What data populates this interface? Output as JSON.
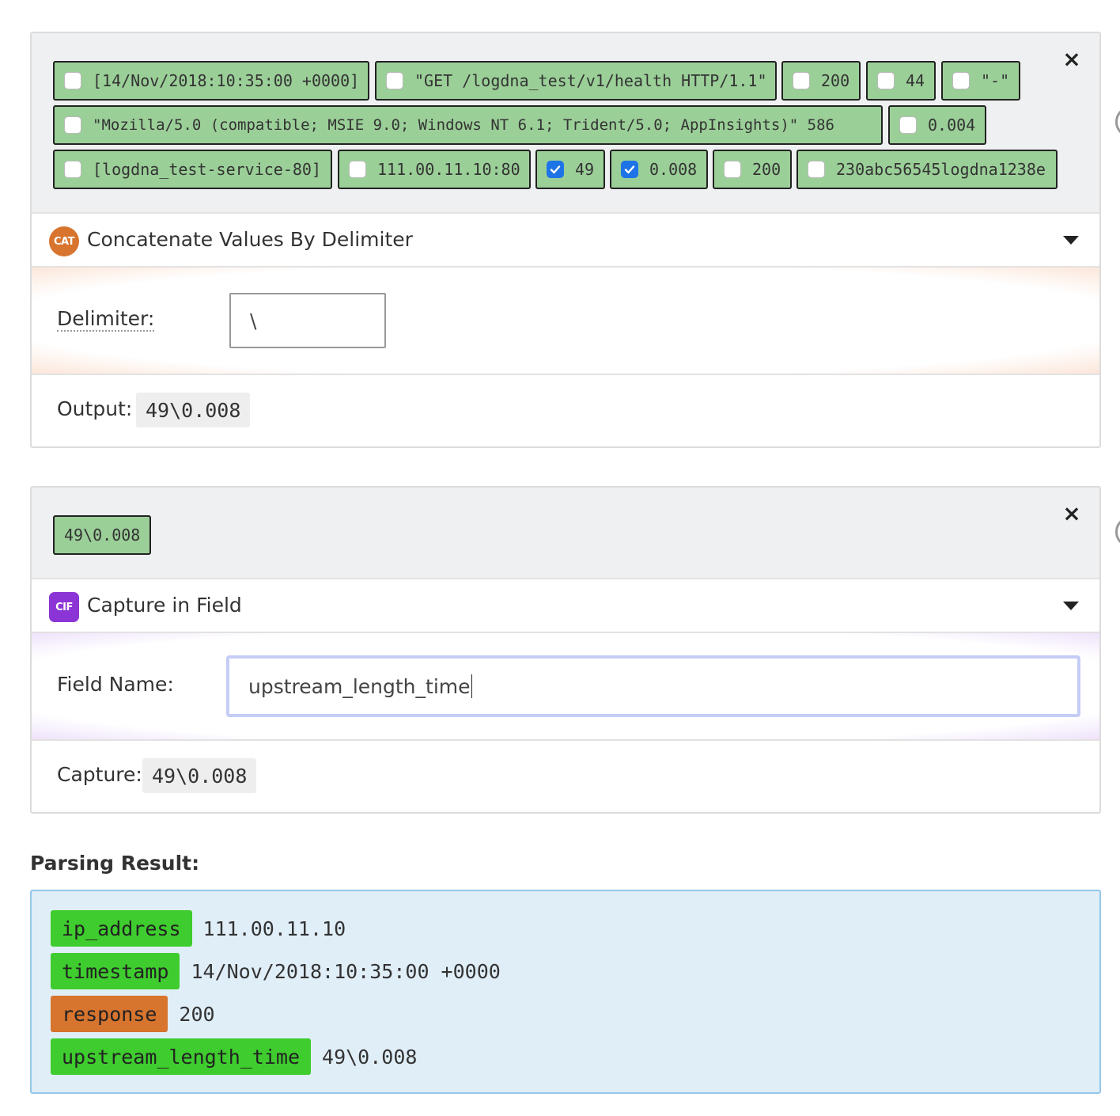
{
  "card1": {
    "tokens": [
      {
        "text": "[14/Nov/2018:10:35:00 +0000]",
        "checked": false
      },
      {
        "text": "\"GET /logdna_test/v1/health HTTP/1.1\"",
        "checked": false
      },
      {
        "text": "200",
        "checked": false
      },
      {
        "text": "44",
        "checked": false
      },
      {
        "text": "\"-\"",
        "checked": false
      },
      {
        "text": "\"Mozilla/5.0 (compatible; MSIE 9.0; Windows NT 6.1; Trident/5.0; AppInsights)\" 586",
        "checked": false
      },
      {
        "text": "0.004",
        "checked": false
      },
      {
        "text": "[logdna_test-service-80]",
        "checked": false
      },
      {
        "text": "111.00.11.10:80",
        "checked": false
      },
      {
        "text": "49",
        "checked": true
      },
      {
        "text": "0.008",
        "checked": true
      },
      {
        "text": "200",
        "checked": false
      },
      {
        "text": "230abc56545logdna1238e",
        "checked": false
      }
    ],
    "close": "×",
    "transform": {
      "badge": "CAT",
      "title": "Concatenate Values By Delimiter"
    },
    "param": {
      "label": "Delimiter:",
      "value": "\\"
    },
    "output": {
      "label": "Output:",
      "value": "49\\0.008"
    }
  },
  "card2": {
    "tokens": [
      {
        "text": "49\\0.008"
      }
    ],
    "close": "×",
    "transform": {
      "badge": "CIF",
      "title": "Capture in Field"
    },
    "param": {
      "label": "Field Name:",
      "value": "upstream_length_time"
    },
    "output": {
      "label": "Capture:",
      "value": "49\\0.008"
    }
  },
  "result": {
    "heading": "Parsing Result:",
    "rows": [
      {
        "key": "ip_address",
        "value": "111.00.11.10",
        "color": "#3ecc2e"
      },
      {
        "key": "timestamp",
        "value": "14/Nov/2018:10:35:00 +0000",
        "color": "#3ecc2e"
      },
      {
        "key": "response",
        "value": "200",
        "color": "#d7742e"
      },
      {
        "key": "upstream_length_time",
        "value": "49\\0.008",
        "color": "#3ecc2e"
      }
    ]
  },
  "colors": {
    "token_bg": "#9bcf98",
    "checkbox_checked": "#1e74e6",
    "result_bg": "#e0eef8"
  }
}
